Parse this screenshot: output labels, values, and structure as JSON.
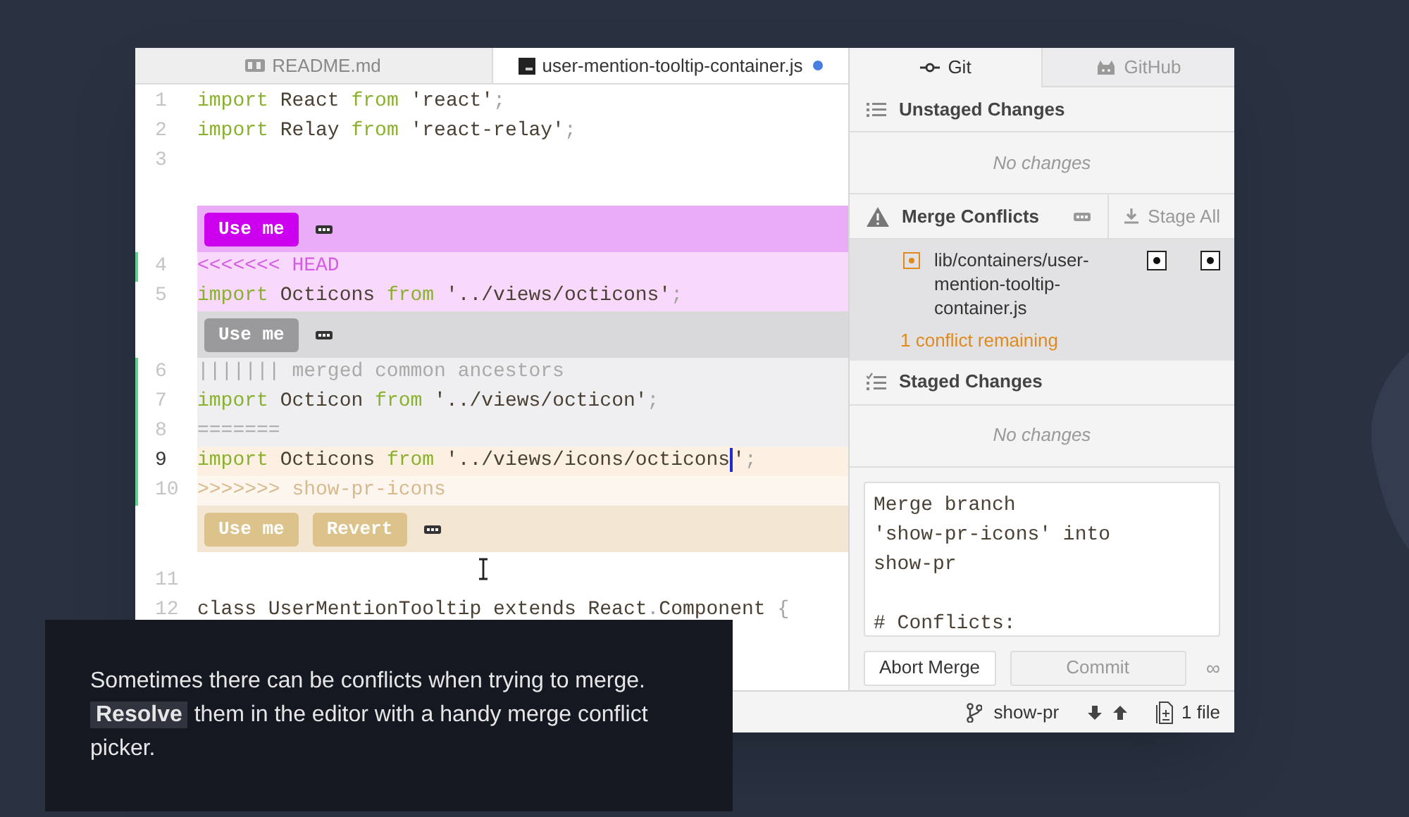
{
  "editor": {
    "tabs": [
      {
        "label": "README.md",
        "kind": "markdown",
        "selected": false,
        "modified": false
      },
      {
        "label": "user-mention-tooltip-container.js",
        "kind": "javascript",
        "selected": true,
        "modified": true
      }
    ],
    "blocks": [
      {
        "kind": "plain",
        "lines": [
          {
            "kind": "code",
            "number": "1",
            "changed": false,
            "current": false,
            "segments": [
              {
                "kind": "keyword",
                "text": "import"
              },
              {
                "kind": "plain",
                "text": " React "
              },
              {
                "kind": "keyword",
                "text": "from"
              },
              {
                "kind": "plain",
                "text": " 'react'"
              },
              {
                "kind": "punct",
                "text": ";"
              }
            ]
          },
          {
            "kind": "code",
            "number": "2",
            "changed": false,
            "current": false,
            "segments": [
              {
                "kind": "keyword",
                "text": "import"
              },
              {
                "kind": "plain",
                "text": " Relay "
              },
              {
                "kind": "keyword",
                "text": "from"
              },
              {
                "kind": "plain",
                "text": " 'react-relay'"
              },
              {
                "kind": "punct",
                "text": ";"
              }
            ]
          },
          {
            "number": "3",
            "changed": false,
            "current": false
          }
        ]
      },
      {
        "kind": "ours",
        "buttons": [
          "Use me"
        ],
        "lines": [
          {
            "kind": "marker",
            "number": "4",
            "changed": true,
            "current": false,
            "segments": [
              {
                "kind": "plain",
                "text": "<<<<<<< HEAD"
              }
            ]
          },
          {
            "kind": "code",
            "number": "5",
            "changed": false,
            "current": false,
            "segments": [
              {
                "kind": "keyword",
                "text": "import"
              },
              {
                "kind": "plain",
                "text": " Octicons "
              },
              {
                "kind": "keyword",
                "text": "from"
              },
              {
                "kind": "plain",
                "text": " '../views/octicons'"
              },
              {
                "kind": "punct",
                "text": ";"
              }
            ]
          }
        ]
      },
      {
        "kind": "base",
        "buttons": [
          "Use me"
        ],
        "lines": [
          {
            "kind": "marker",
            "number": "6",
            "changed": true,
            "current": false,
            "segments": [
              {
                "kind": "plain",
                "text": "||||||| merged common ancestors"
              }
            ]
          },
          {
            "kind": "code",
            "number": "7",
            "changed": true,
            "current": false,
            "segments": [
              {
                "kind": "keyword",
                "text": "import"
              },
              {
                "kind": "plain",
                "text": " Octicon "
              },
              {
                "kind": "keyword",
                "text": "from"
              },
              {
                "kind": "plain",
                "text": " '../views/octicon'"
              },
              {
                "kind": "punct",
                "text": ";"
              }
            ]
          },
          {
            "kind": "marker",
            "number": "8",
            "changed": true,
            "current": false,
            "segments": [
              {
                "kind": "plain",
                "text": "======="
              }
            ]
          }
        ]
      },
      {
        "kind": "theirs",
        "buttons": [
          "Use me",
          "Revert"
        ],
        "lines": [
          {
            "kind": "code",
            "number": "9",
            "changed": true,
            "current": true,
            "segments": [
              {
                "kind": "keyword",
                "text": "import"
              },
              {
                "kind": "plain",
                "text": " Octicons "
              },
              {
                "kind": "keyword",
                "text": "from"
              },
              {
                "kind": "plain",
                "text": " '../views/icons/octicons"
              },
              {
                "kind": "cursor"
              },
              {
                "kind": "plain",
                "text": "'"
              },
              {
                "kind": "punct",
                "text": ";"
              }
            ]
          },
          {
            "kind": "marker",
            "number": "10",
            "changed": true,
            "current": false,
            "segments": [
              {
                "kind": "plain",
                "text": ">>>>>>> show-pr-icons"
              }
            ]
          }
        ]
      },
      {
        "kind": "plain",
        "lines": [
          {
            "number": "11",
            "changed": false,
            "current": false
          },
          {
            "kind": "code",
            "number": "12",
            "changed": false,
            "current": false,
            "segments": [
              {
                "kind": "plain",
                "text": "class UserMentionTooltip extends React"
              },
              {
                "kind": "punct",
                "text": "."
              },
              {
                "kind": "plain",
                "text": "Component "
              },
              {
                "kind": "punct",
                "text": "{"
              }
            ]
          }
        ]
      }
    ]
  },
  "git_panel": {
    "tabs": [
      {
        "label": "Git",
        "selected": true
      },
      {
        "label": "GitHub",
        "selected": false
      }
    ],
    "unstaged": {
      "title": "Unstaged Changes",
      "empty": "No changes"
    },
    "conflicts": {
      "title": "Merge Conflicts",
      "action": "Stage All",
      "files": [
        {
          "path": "lib/containers/user-mention-tooltip-container.js",
          "status": "1 conflict remaining",
          "selected": true
        }
      ]
    },
    "staged": {
      "title": "Staged Changes",
      "empty": "No changes"
    },
    "commit_message": "Merge branch\n'show-pr-icons' into\nshow-pr\n\n# Conflicts:",
    "buttons": [
      {
        "label": "Abort Merge",
        "disabled": false
      },
      {
        "label": "Commit",
        "disabled": true
      }
    ],
    "coauthor": "∞"
  },
  "status_bar": {
    "branch": "show-pr",
    "changes": "1 file"
  },
  "caption": "Sometimes there can be conflicts when trying to merge. **Resolve** them in the editor with a handy merge conflict picker."
}
